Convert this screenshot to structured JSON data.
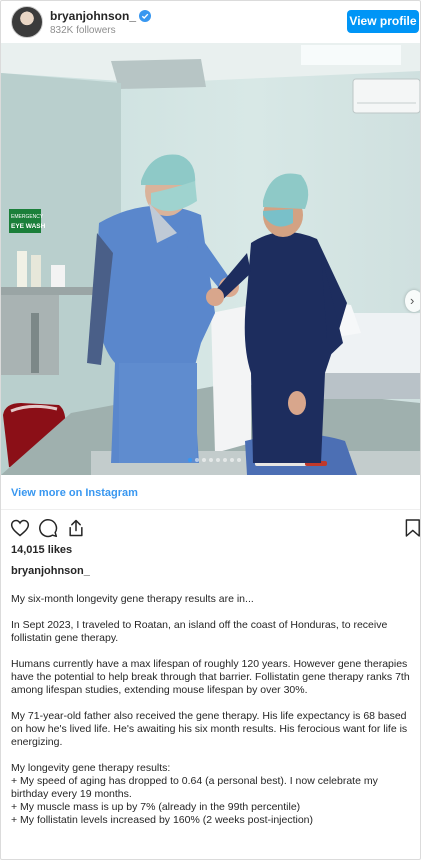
{
  "header": {
    "username": "bryanjohnson_",
    "followers": "832K followers",
    "view_profile_label": "View profile"
  },
  "photo": {
    "sign_line1": "EMERGENCY",
    "sign_line2": "EYE WASH",
    "carousel_slide_count": 8,
    "carousel_active_index": 0
  },
  "view_more_label": "View more on Instagram",
  "icons": [
    "heart-icon",
    "comment-icon",
    "share-icon",
    "bookmark-icon",
    "verified-badge-icon",
    "chevron-right-icon"
  ],
  "likes": "14,015 likes",
  "caption_author": "bryanjohnson_",
  "caption": {
    "p1": "My six-month longevity gene therapy results are in...",
    "p2": "In Sept 2023, I traveled to Roatan, an island off the coast of Honduras, to receive follistatin gene therapy.",
    "p3": "Humans currently have a max lifespan of roughly 120 years. However gene therapies have the potential to help break through that barrier. Follistatin gene therapy ranks 7th among lifespan studies, extending mouse lifespan by over 30%.",
    "p4": "My 71-year-old father also received the gene therapy. His life expectancy is 68 based on how he's lived life. He's awaiting his six month results. His ferocious want for life is energizing.",
    "p5_title": "My longevity gene therapy results:",
    "p5_items": [
      "+ My speed of aging has dropped to 0.64 (a personal best). I now celebrate my birthday every 19 months.",
      "+ My muscle mass is up by 7% (already in the 99th percentile)",
      "+ My follistatin levels increased by 160% (2 weeks post-injection)"
    ]
  },
  "colors": {
    "accent_blue": "#0095f6",
    "link_blue": "#3897f0",
    "text": "#262626",
    "muted": "#8e8e8e"
  }
}
